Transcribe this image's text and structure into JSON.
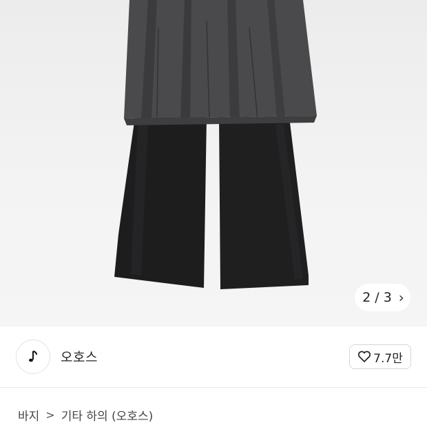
{
  "product_image": {
    "description_icon": "pleated-skirt-layered-pants-photo"
  },
  "pager": {
    "current": "2",
    "separator": "/",
    "total": "3",
    "next_icon": "chevron-right-icon"
  },
  "store": {
    "logo_icon": "music-note-icon",
    "name": "오호스"
  },
  "like": {
    "icon": "heart-outline-icon",
    "count": "7.7만"
  },
  "breadcrumb": {
    "items": [
      "바지",
      "기타 하의 (오호스)"
    ],
    "separator": ">"
  }
}
